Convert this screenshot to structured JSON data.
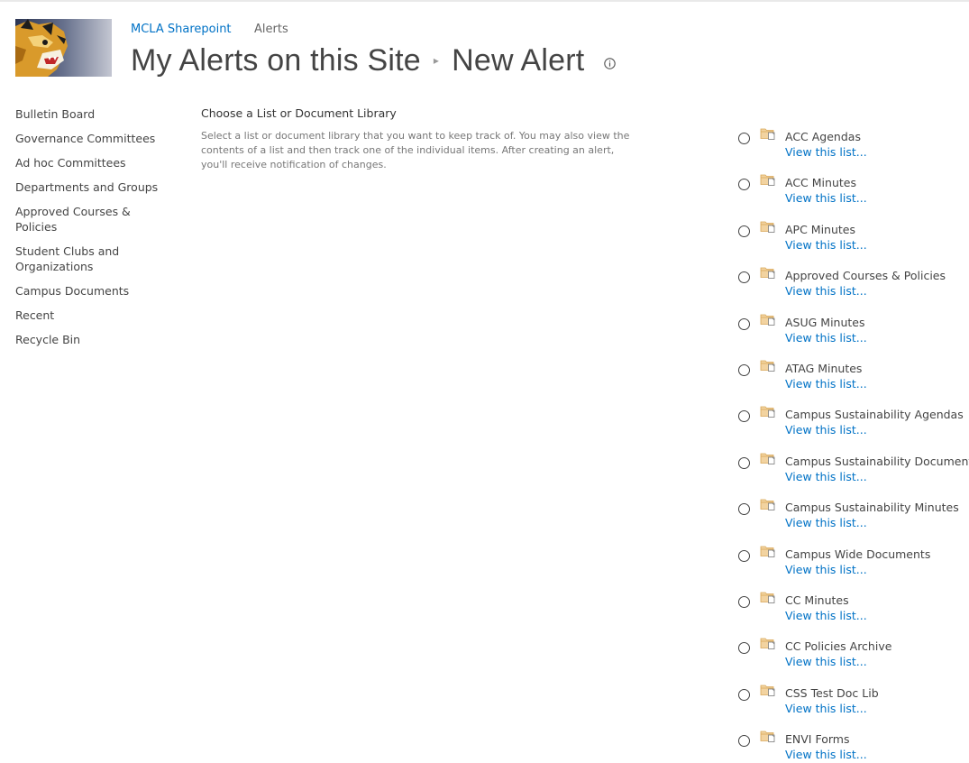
{
  "header": {
    "site_link": "MCLA Sharepoint",
    "alerts_link": "Alerts",
    "title": "My Alerts on this Site",
    "title_separator": "▸",
    "subtitle": "New Alert"
  },
  "quicklaunch": {
    "items": [
      {
        "label": "Bulletin Board"
      },
      {
        "label": "Governance Committees"
      },
      {
        "label": "Ad hoc Committees"
      },
      {
        "label": "Departments and Groups"
      },
      {
        "label": "Approved Courses & Policies"
      },
      {
        "label": "Student Clubs and Organizations"
      },
      {
        "label": "Campus Documents"
      },
      {
        "label": "Recent"
      },
      {
        "label": "Recycle Bin"
      }
    ]
  },
  "section": {
    "title": "Choose a List or Document Library",
    "description": "Select a list or document library that you want to keep track of. You may also view the contents of a list and then track one of the individual items. After creating an alert, you'll receive notification of changes."
  },
  "libraries": {
    "view_label": "View this list...",
    "items": [
      {
        "name": "ACC Agendas"
      },
      {
        "name": "ACC Minutes"
      },
      {
        "name": "APC Minutes"
      },
      {
        "name": "Approved Courses & Policies"
      },
      {
        "name": "ASUG Minutes"
      },
      {
        "name": "ATAG Minutes"
      },
      {
        "name": "Campus Sustainability Agendas"
      },
      {
        "name": "Campus Sustainability Documents"
      },
      {
        "name": "Campus Sustainability Minutes"
      },
      {
        "name": "Campus Wide Documents"
      },
      {
        "name": "CC Minutes"
      },
      {
        "name": "CC Policies Archive"
      },
      {
        "name": "CSS Test Doc Lib"
      },
      {
        "name": "ENVI Forms"
      }
    ]
  },
  "colors": {
    "link_blue": "#0072c6",
    "text": "#444444",
    "muted": "#777777",
    "icon_folder": "#e8b86d"
  },
  "icons": {
    "logo": "mascot-logo",
    "info": "info-icon",
    "library": "document-library-icon"
  }
}
